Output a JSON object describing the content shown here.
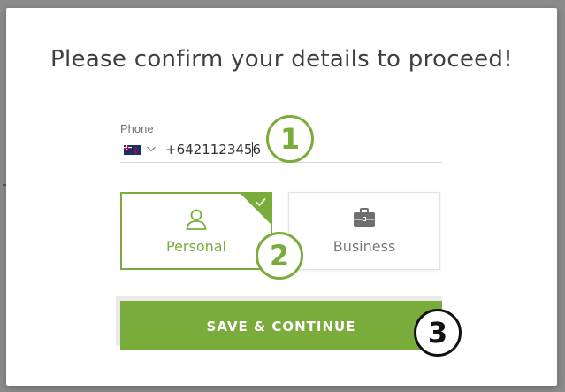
{
  "modal": {
    "title": "Please confirm your details to proceed!",
    "phone": {
      "label": "Phone",
      "country_flag": "nz-flag-icon",
      "value": "+6421123456"
    },
    "account_types": [
      {
        "label": "Personal",
        "icon": "person-icon",
        "selected": true
      },
      {
        "label": "Business",
        "icon": "briefcase-icon",
        "selected": false
      }
    ],
    "save_button_label": "SAVE & CONTINUE"
  },
  "annotations": [
    {
      "label": "1"
    },
    {
      "label": "2"
    },
    {
      "label": "3"
    }
  ],
  "colors": {
    "accent": "#7aac3c",
    "title": "#3f3f3f",
    "muted": "#7a7a7a",
    "overlay": "#8b8b8b"
  }
}
